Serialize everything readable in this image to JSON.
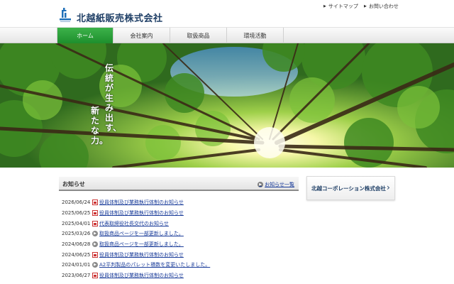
{
  "header": {
    "company_name": "北越紙販売株式会社",
    "utility_links": [
      {
        "label": "サイトマップ"
      },
      {
        "label": "お問い合わせ"
      }
    ]
  },
  "nav": {
    "items": [
      {
        "label": "ホーム",
        "active": true
      },
      {
        "label": "会社案内",
        "active": false
      },
      {
        "label": "取扱商品",
        "active": false
      },
      {
        "label": "環境活動",
        "active": false
      }
    ]
  },
  "hero": {
    "tagline_line1": "伝統が生み出す、",
    "tagline_line2": "新たな力。"
  },
  "news": {
    "title": "お知らせ",
    "more_label": "お知らせ一覧",
    "items": [
      {
        "date": "2026/06/24",
        "icon": "pdf-icon",
        "text": "役員体制及び業務執行体制のお知らせ"
      },
      {
        "date": "2025/06/25",
        "icon": "pdf-icon",
        "text": "役員体制及び業務執行体制のお知らせ"
      },
      {
        "date": "2025/04/01",
        "icon": "pdf-icon",
        "text": "代表取締役社長交代のお知らせ"
      },
      {
        "date": "2025/03/26",
        "icon": "circle-arrow-icon",
        "text": "取扱商品ページを一部更新しました。"
      },
      {
        "date": "2024/06/28",
        "icon": "circle-arrow-icon",
        "text": "取扱商品ページを一部更新しました。"
      },
      {
        "date": "2024/06/25",
        "icon": "pdf-icon",
        "text": "役員体制及び業務執行体制のお知らせ"
      },
      {
        "date": "2024/01/01",
        "icon": "circle-arrow-icon",
        "text": "A2平判製品のパレット積数を変更いたしました。"
      },
      {
        "date": "2023/06/27",
        "icon": "pdf-icon",
        "text": "役員体制及び業務執行体制のお知らせ"
      }
    ]
  },
  "side_banner": {
    "label": "北越コーポレーション株式会社"
  },
  "colors": {
    "brand_navy": "#1f3f66",
    "nav_active_green": "#2a9e3a",
    "link_blue": "#1a3c9a"
  }
}
